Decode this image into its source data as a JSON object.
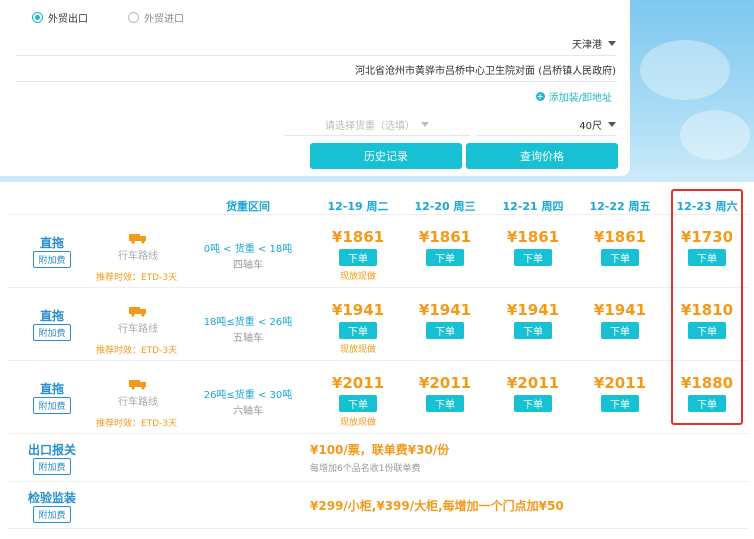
{
  "form": {
    "radio_export": "外贸出口",
    "radio_import": "外贸进口",
    "port": "天津港",
    "address": "河北省沧州市黄骅市吕桥中心卫生院对面 (吕桥镇人民政府)",
    "add_address": "添加装/卸地址",
    "weight_placeholder": "请选择货重（选填）",
    "container": "40尺",
    "history_btn": "历史记录",
    "query_btn": "查询价格"
  },
  "table": {
    "headers": [
      "货重区间",
      "12-19 周二",
      "12-20 周三",
      "12-21 周四",
      "12-22 周五",
      "12-23 周六"
    ],
    "order_label": "下单",
    "rows": [
      {
        "service": "直拖",
        "fee_tag": "附加费",
        "route": "行车路线",
        "eta": "推荐时效：ETD-3天",
        "weight": "0吨 < 货重 < 18吨",
        "axle": "四轴车",
        "prices": [
          "¥1861",
          "¥1861",
          "¥1861",
          "¥1861",
          "¥1730"
        ],
        "cash": "现放现做"
      },
      {
        "service": "直拖",
        "fee_tag": "附加费",
        "route": "行车路线",
        "eta": "推荐时效：ETD-3天",
        "weight": "18吨≤货重 < 26吨",
        "axle": "五轴车",
        "prices": [
          "¥1941",
          "¥1941",
          "¥1941",
          "¥1941",
          "¥1810"
        ],
        "cash": "现放现做"
      },
      {
        "service": "直拖",
        "fee_tag": "附加费",
        "route": "行车路线",
        "eta": "推荐时效：ETD-3天",
        "weight": "26吨≤货重 < 30吨",
        "axle": "六轴车",
        "prices": [
          "¥2011",
          "¥2011",
          "¥2011",
          "¥2011",
          "¥1880"
        ],
        "cash": "现放现做"
      }
    ],
    "extras": [
      {
        "service": "出口报关",
        "fee_tag": "附加费",
        "price": "¥100/票，联单费¥30/份",
        "note": "每增加6个品名收1份联单费"
      },
      {
        "service": "检验监装",
        "fee_tag": "附加费",
        "price": "¥299/小柜,¥399/大柜,每增加一个门点加¥50",
        "note": ""
      }
    ]
  },
  "colors": {
    "accent": "#17c1d3",
    "price": "#f39a1a",
    "header": "#1aa6d6",
    "highlight": "#e4322b"
  }
}
